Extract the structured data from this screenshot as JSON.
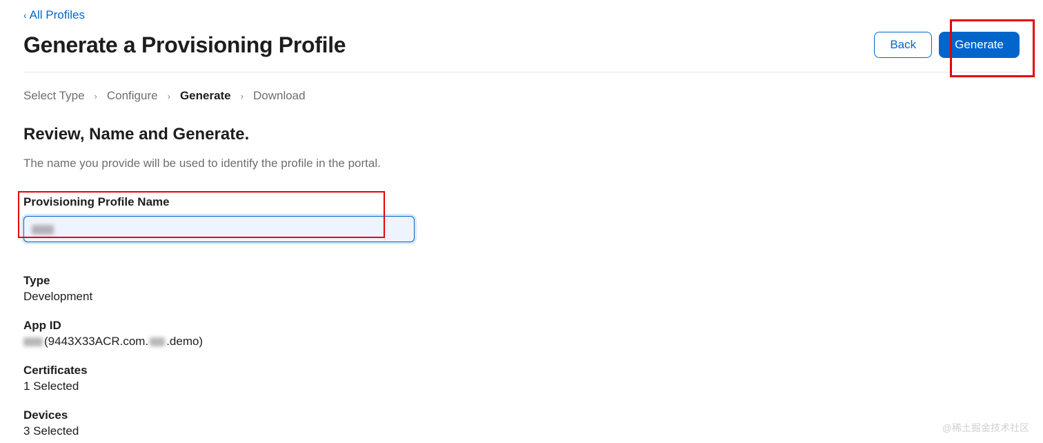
{
  "nav": {
    "back_link": "All Profiles"
  },
  "header": {
    "title": "Generate a Provisioning Profile",
    "back_button": "Back",
    "generate_button": "Generate"
  },
  "breadcrumb": {
    "step1": "Select Type",
    "step2": "Configure",
    "step3": "Generate",
    "step4": "Download"
  },
  "section": {
    "title": "Review, Name and Generate.",
    "desc": "The name you provide will be used to identify the profile in the portal."
  },
  "form": {
    "profile_name_label": "Provisioning Profile Name",
    "profile_name_value": ""
  },
  "info": {
    "type_label": "Type",
    "type_value": "Development",
    "appid_label": "App ID",
    "appid_prefix": "",
    "appid_mid": "(9443X33ACR.com.",
    "appid_suffix": ".demo)",
    "certs_label": "Certificates",
    "certs_value": "1 Selected",
    "devices_label": "Devices",
    "devices_value": "3 Selected"
  },
  "watermark": "@稀土掘金技术社区"
}
